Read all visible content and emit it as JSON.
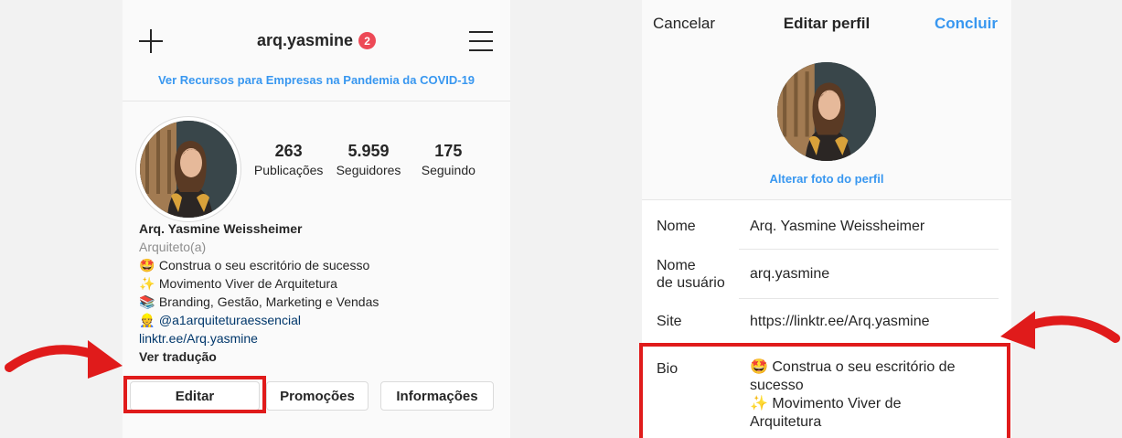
{
  "profile": {
    "username": "arq.yasmine",
    "notification_count": "2",
    "covid_banner": "Ver Recursos para Empresas na Pandemia da COVID-19",
    "stats": [
      {
        "value": "263",
        "label": "Publicações"
      },
      {
        "value": "5.959",
        "label": "Seguidores"
      },
      {
        "value": "175",
        "label": "Seguindo"
      }
    ],
    "name": "Arq. Yasmine Weissheimer",
    "category": "Arquiteto(a)",
    "bio_lines": [
      {
        "emoji": "🤩",
        "text": "Construa o seu escritório de sucesso"
      },
      {
        "emoji": "✨",
        "text": "Movimento Viver de Arquitetura"
      },
      {
        "emoji": "📚",
        "text": "Branding, Gestão, Marketing e Vendas"
      },
      {
        "emoji": "👷",
        "text": "@a1arquiteturaessencial"
      }
    ],
    "link": "linktr.ee/Arq.yasmine",
    "see_translation": "Ver tradução",
    "buttons": {
      "edit": "Editar",
      "promotions": "Promoções",
      "info": "Informações"
    }
  },
  "edit_profile": {
    "cancel": "Cancelar",
    "title": "Editar perfil",
    "done": "Concluir",
    "change_photo": "Alterar foto do perfil",
    "fields": {
      "name_label": "Nome",
      "name_value": "Arq. Yasmine Weissheimer",
      "username_label_1": "Nome",
      "username_label_2": "de usuário",
      "username_value": "arq.yasmine",
      "site_label": "Site",
      "site_value": "https://linktr.ee/Arq.yasmine",
      "bio_label": "Bio",
      "bio_line_1": "🤩 Construa o seu escritório de",
      "bio_line_2": "sucesso",
      "bio_line_3": "✨ Movimento Viver de",
      "bio_line_4": "Arquitetura"
    }
  },
  "colors": {
    "accent_blue": "#3897f0",
    "annotation_red": "#e01b1b",
    "badge_red": "#ed4956",
    "link_navy": "#00376b"
  },
  "icons": [
    "plus-icon",
    "menu-icon",
    "curved-arrow-icon"
  ]
}
